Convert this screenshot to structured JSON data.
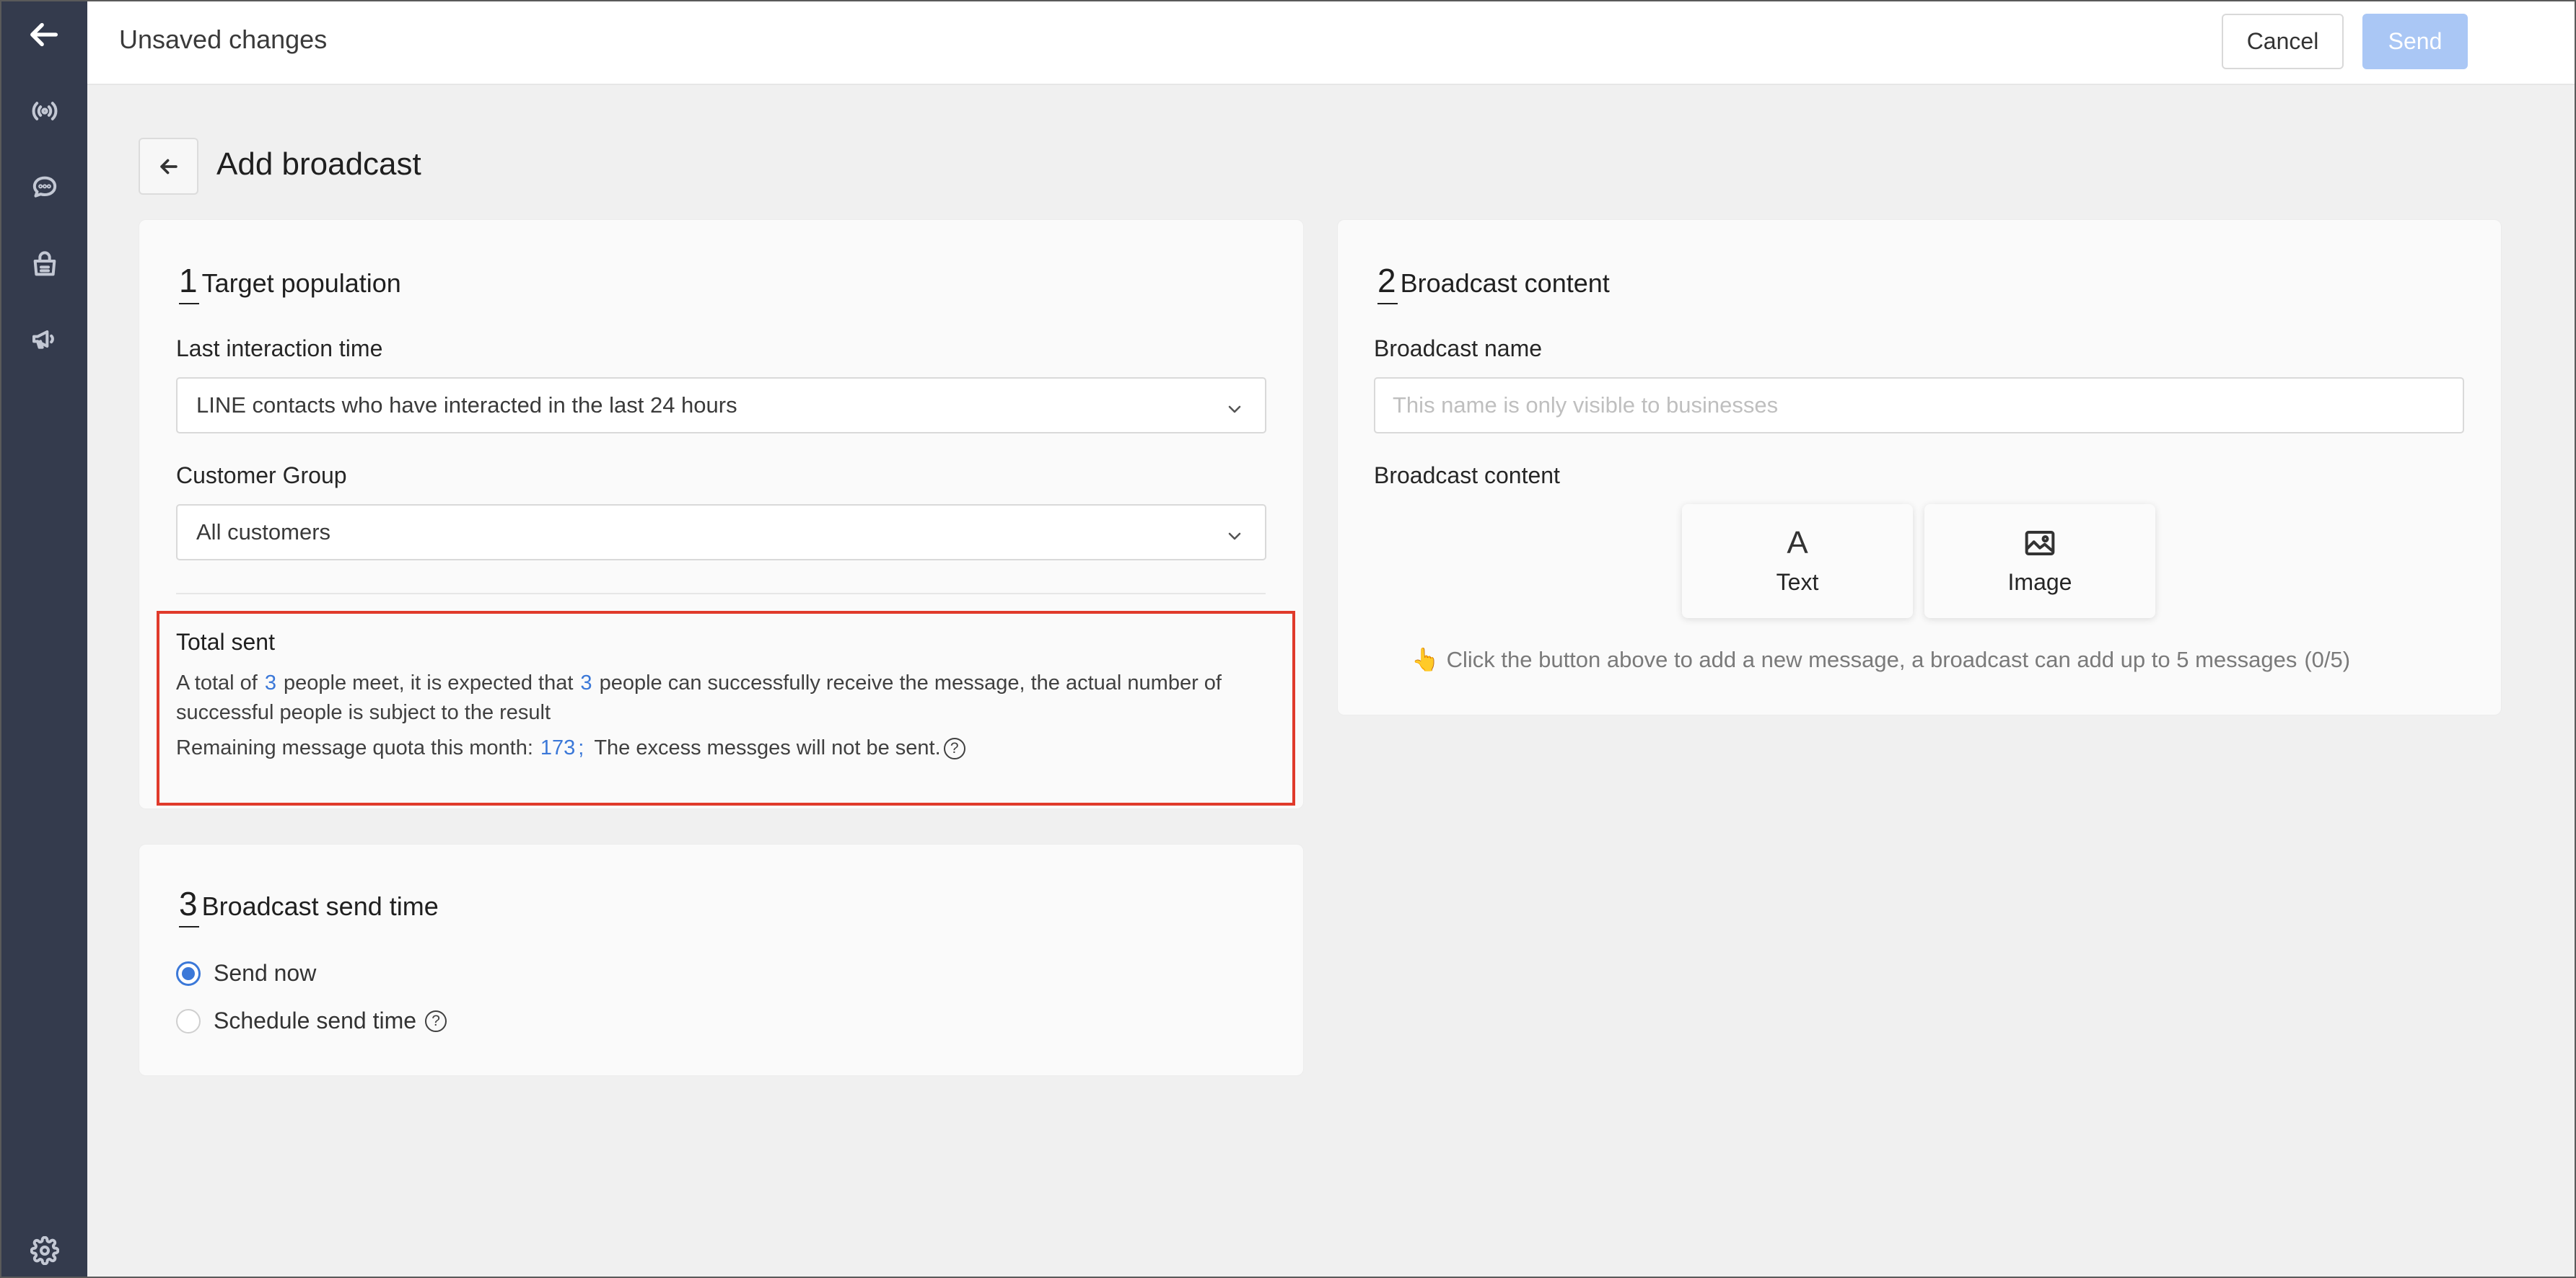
{
  "topbar": {
    "title": "Unsaved changes",
    "cancel_label": "Cancel",
    "send_label": "Send"
  },
  "sidebar": {
    "items": [
      {
        "icon": "back-arrow-icon"
      },
      {
        "icon": "broadcast-icon"
      },
      {
        "icon": "chat-icon"
      },
      {
        "icon": "shop-bag-icon"
      },
      {
        "icon": "megaphone-icon"
      },
      {
        "icon": "gear-icon"
      }
    ]
  },
  "page": {
    "title": "Add broadcast"
  },
  "target": {
    "num": "1",
    "heading": "Target population",
    "last_interaction_label": "Last interaction time",
    "last_interaction_value": "LINE contacts who have interacted in the last 24 hours",
    "customer_group_label": "Customer Group",
    "customer_group_value": "All customers",
    "total_sent_title": "Total sent",
    "total_text_1": "A total of",
    "total_count": "3",
    "total_text_2": "people meet, it is expected that",
    "expected_count": "3",
    "total_text_3": "people can successfully receive the message, the actual number of successful people is subject to the result",
    "quota_label": "Remaining message quota this month:",
    "quota_value": "173",
    "quota_sep": ";",
    "quota_note": "The excess messges will not be sent."
  },
  "send_time": {
    "num": "3",
    "heading": "Broadcast send time",
    "options": [
      {
        "label": "Send now",
        "checked": true
      },
      {
        "label": "Schedule send time",
        "checked": false
      }
    ]
  },
  "content": {
    "num": "2",
    "heading": "Broadcast content",
    "name_label": "Broadcast name",
    "name_placeholder": "This name is only visible to businesses",
    "content_label": "Broadcast content",
    "buttons": [
      {
        "glyph": "A",
        "label": "Text",
        "icon": "text-icon"
      },
      {
        "label": "Image",
        "icon": "image-icon"
      }
    ],
    "hint_emoji": "👆",
    "hint": "Click the button above to add a new message, a broadcast can add up to 5 messages",
    "hint_count": "(0/5)"
  },
  "colors": {
    "accent": "#3b78d8",
    "sidebar_bg": "#343b4d",
    "send_disabled": "#aac7f5",
    "highlight": "#e03a2b"
  }
}
